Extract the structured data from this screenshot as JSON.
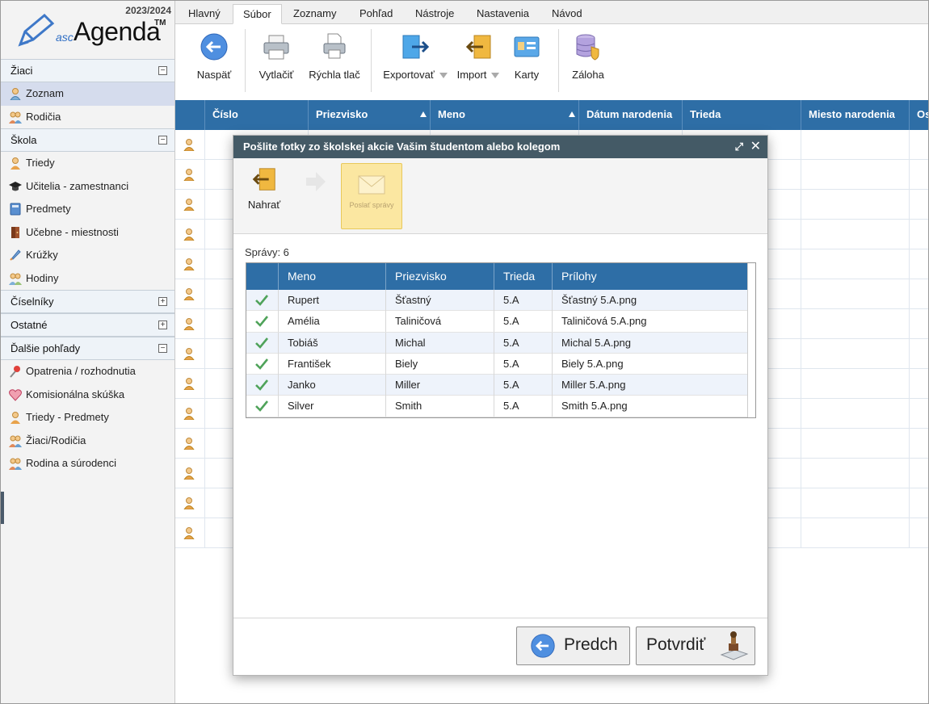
{
  "sidebar": {
    "year": "2023/2024",
    "brand_prefix": "asc",
    "brand_name": "Agenda",
    "brand_tm": "TM",
    "sections": {
      "ziaci": {
        "label": "Žiaci",
        "toggle": "−",
        "items": [
          "Zoznam",
          "Rodičia"
        ]
      },
      "skola": {
        "label": "Škola",
        "toggle": "−",
        "items": [
          "Triedy",
          "Učitelia - zamestnanci",
          "Predmety",
          "Učebne - miestnosti",
          "Krúžky",
          "Hodiny"
        ]
      },
      "ciselniky": {
        "label": "Číselníky",
        "toggle": "+"
      },
      "ostatne": {
        "label": "Ostatné",
        "toggle": "+"
      },
      "dalsie": {
        "label": "Ďalšie pohľady",
        "toggle": "−",
        "items": [
          "Opatrenia / rozhodnutia",
          "Komisionálna skúška",
          "Triedy - Predmety",
          "Žiaci/Rodičia",
          "Rodina a súrodenci"
        ]
      }
    }
  },
  "tabs": [
    "Hlavný",
    "Súbor",
    "Zoznamy",
    "Pohľad",
    "Nástroje",
    "Nastavenia",
    "Návod"
  ],
  "ribbon": {
    "back": "Naspäť",
    "print": "Vytlačiť",
    "quick_print": "Rýchla tlač",
    "export": "Exportovať",
    "import": "Import",
    "cards": "Karty",
    "backup": "Záloha"
  },
  "grid": {
    "columns": [
      "Číslo",
      "Priezvisko",
      "Meno",
      "Dátum narodenia",
      "Trieda",
      "Miesto narodenia",
      "Os"
    ]
  },
  "dialog": {
    "title": "Pošlite fotky zo školskej akcie Vašim študentom alebo kolegom",
    "upload": "Nahrať",
    "send": "Poslať správy",
    "count": "Správy: 6",
    "columns": [
      "Meno",
      "Priezvisko",
      "Trieda",
      "Prílohy"
    ],
    "rows": [
      {
        "meno": "Rupert",
        "priezvisko": "Šťastný",
        "trieda": "5.A",
        "prilohy": "Šťastný 5.A.png"
      },
      {
        "meno": "Amélia",
        "priezvisko": "Taliničová",
        "trieda": "5.A",
        "prilohy": "Taliničová 5.A.png"
      },
      {
        "meno": "Tobiáš",
        "priezvisko": "Michal",
        "trieda": "5.A",
        "prilohy": "Michal 5.A.png"
      },
      {
        "meno": "František",
        "priezvisko": "Biely",
        "trieda": "5.A",
        "prilohy": "Biely 5.A.png"
      },
      {
        "meno": "Janko",
        "priezvisko": "Miller",
        "trieda": "5.A",
        "prilohy": "Miller 5.A.png"
      },
      {
        "meno": "Silver",
        "priezvisko": "Smith",
        "trieda": "5.A",
        "prilohy": "Smith 5.A.png"
      }
    ],
    "prev": "Predch",
    "confirm": "Potvrdiť"
  },
  "colors": {
    "header_blue": "#2e6ea6",
    "dialog_title": "#445a66",
    "accent_yellow": "#fbe7a1"
  }
}
